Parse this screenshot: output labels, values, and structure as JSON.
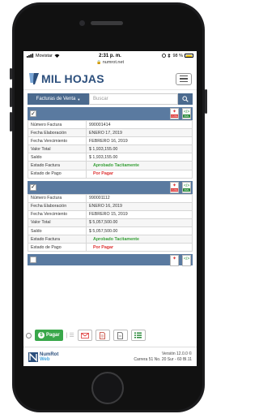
{
  "status_bar": {
    "carrier": "Movistar",
    "time": "2:31 p. m.",
    "battery": "98 %"
  },
  "browser": {
    "url": "numrot.net"
  },
  "header": {
    "logo_text": "MIL HOJAS"
  },
  "filter": {
    "dropdown_label": "Facturas de Venta",
    "search_placeholder": "Buscar"
  },
  "labels": {
    "numero": "Número Factura",
    "elaboracion": "Fecha Elaboración",
    "vencimiento": "Fecha Vencimiento",
    "valor": "Valor Total",
    "saldo": "Saldo",
    "estado_factura": "Estado Factura",
    "estado_pago": "Estado de Pago"
  },
  "icons": {
    "pdf_label": "CUFE",
    "xml_label": "XML"
  },
  "invoices": [
    {
      "checked": true,
      "numero": "990001414",
      "elaboracion": "ENERO 17, 2019",
      "vencimiento": "FEBRERO 16, 2019",
      "valor": "$ 1,933,155.00",
      "saldo": "$ 1,933,155.00",
      "estado_factura": "Aprobado Tacitamente",
      "estado_pago": "Por Pagar"
    },
    {
      "checked": true,
      "numero": "990001112",
      "elaboracion": "ENERO 16, 2019",
      "vencimiento": "FEBRERO 15, 2019",
      "valor": "$ 5,057,500.00",
      "saldo": "$ 5,057,500.00",
      "estado_factura": "Aprobado Tacitamente",
      "estado_pago": "Por Pagar"
    }
  ],
  "toolbar": {
    "pagar_label": "Pagar"
  },
  "footer": {
    "logo_top": "NumRot",
    "logo_bottom": "Web",
    "version": "Versión 12.0.0 ©",
    "address": "Carrera 51 No. 20 Sur - 60 Bl.11"
  },
  "colors": {
    "primary": "#4b6a8e",
    "card_header": "#5a7aa0",
    "approved": "#38a038",
    "pending": "#dd3333",
    "pay_button": "#39a74a"
  }
}
